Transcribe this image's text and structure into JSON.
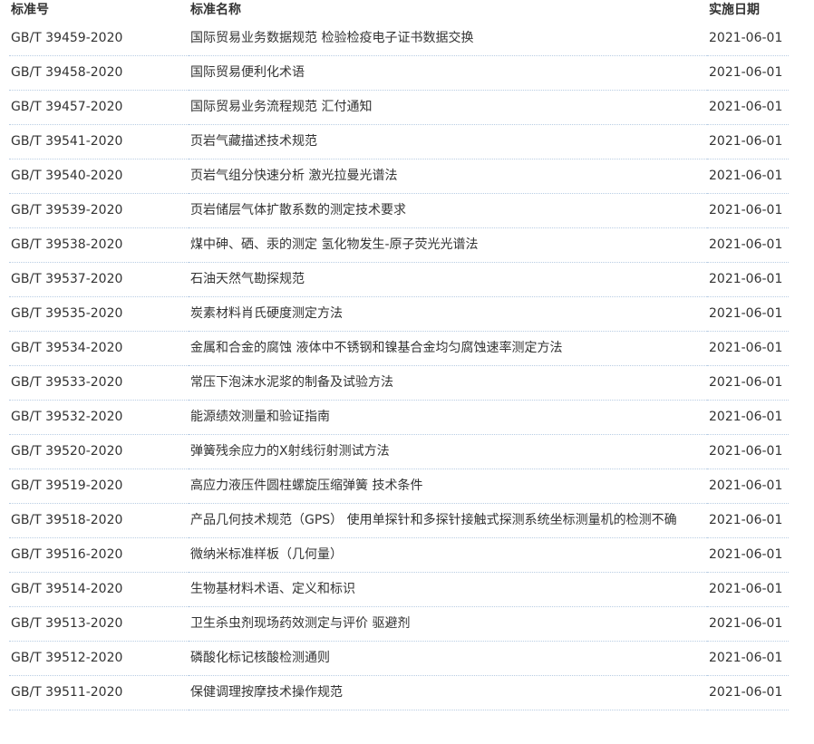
{
  "header": {
    "code": "标准号",
    "name": "标准名称",
    "date": "实施日期"
  },
  "rows": [
    {
      "code": "GB/T 39459-2020",
      "name": "国际贸易业务数据规范 检验检疫电子证书数据交换",
      "date": "2021-06-01"
    },
    {
      "code": "GB/T 39458-2020",
      "name": "国际贸易便利化术语",
      "date": "2021-06-01"
    },
    {
      "code": "GB/T 39457-2020",
      "name": "国际贸易业务流程规范 汇付通知",
      "date": "2021-06-01"
    },
    {
      "code": "GB/T 39541-2020",
      "name": "页岩气藏描述技术规范",
      "date": "2021-06-01"
    },
    {
      "code": "GB/T 39540-2020",
      "name": "页岩气组分快速分析 激光拉曼光谱法",
      "date": "2021-06-01"
    },
    {
      "code": "GB/T 39539-2020",
      "name": "页岩储层气体扩散系数的测定技术要求",
      "date": "2021-06-01"
    },
    {
      "code": "GB/T 39538-2020",
      "name": "煤中砷、硒、汞的测定 氢化物发生-原子荧光光谱法",
      "date": "2021-06-01"
    },
    {
      "code": "GB/T 39537-2020",
      "name": "石油天然气勘探规范",
      "date": "2021-06-01"
    },
    {
      "code": "GB/T 39535-2020",
      "name": "炭素材料肖氏硬度测定方法",
      "date": "2021-06-01"
    },
    {
      "code": "GB/T 39534-2020",
      "name": "金属和合金的腐蚀 液体中不锈钢和镍基合金均匀腐蚀速率测定方法",
      "date": "2021-06-01"
    },
    {
      "code": "GB/T 39533-2020",
      "name": "常压下泡沫水泥浆的制备及试验方法",
      "date": "2021-06-01"
    },
    {
      "code": "GB/T 39532-2020",
      "name": "能源绩效测量和验证指南",
      "date": "2021-06-01"
    },
    {
      "code": "GB/T 39520-2020",
      "name": "弹簧残余应力的X射线衍射测试方法",
      "date": "2021-06-01"
    },
    {
      "code": "GB/T 39519-2020",
      "name": "高应力液压件圆柱螺旋压缩弹簧 技术条件",
      "date": "2021-06-01"
    },
    {
      "code": "GB/T 39518-2020",
      "name": "产品几何技术规范（GPS） 使用单探针和多探针接触式探测系统坐标测量机的检测不确",
      "date": "2021-06-01"
    },
    {
      "code": "GB/T 39516-2020",
      "name": "微纳米标准样板（几何量）",
      "date": "2021-06-01"
    },
    {
      "code": "GB/T 39514-2020",
      "name": "生物基材料术语、定义和标识",
      "date": "2021-06-01"
    },
    {
      "code": "GB/T 39513-2020",
      "name": "卫生杀虫剂现场药效测定与评价 驱避剂",
      "date": "2021-06-01"
    },
    {
      "code": "GB/T 39512-2020",
      "name": "磷酸化标记核酸检测通则",
      "date": "2021-06-01"
    },
    {
      "code": "GB/T 39511-2020",
      "name": "保健调理按摩技术操作规范",
      "date": "2021-06-01"
    }
  ]
}
